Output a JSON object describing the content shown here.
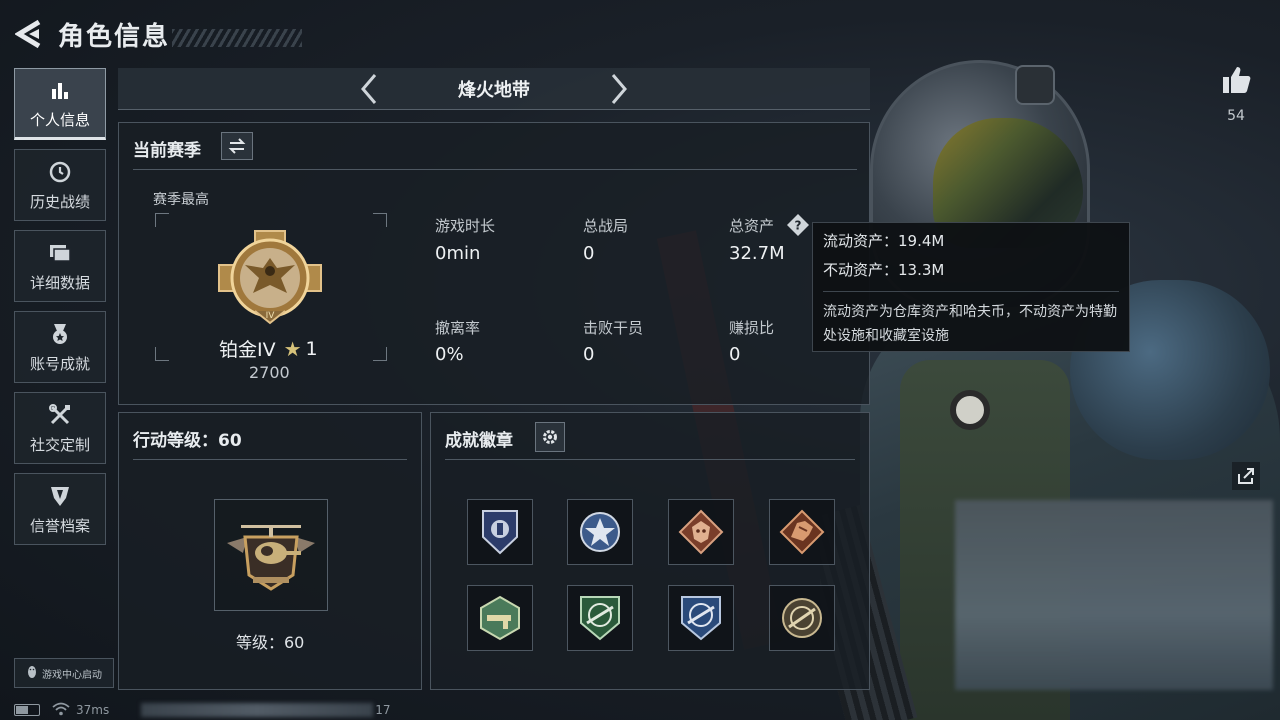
{
  "header": {
    "title": "角色信息"
  },
  "sidebar": {
    "items": [
      {
        "label": "个人信息",
        "icon": "bar-chart-icon",
        "active": true
      },
      {
        "label": "历史战绩",
        "icon": "history-icon"
      },
      {
        "label": "详细数据",
        "icon": "folder-icon"
      },
      {
        "label": "账号成就",
        "icon": "medal-icon"
      },
      {
        "label": "社交定制",
        "icon": "tools-icon"
      },
      {
        "label": "信誉档案",
        "icon": "shield-icon"
      }
    ],
    "launch_label": "游戏中心启动"
  },
  "mode": {
    "title": "烽火地带"
  },
  "season": {
    "title": "当前赛季",
    "best_label": "赛季最高",
    "rank_name": "铂金IV",
    "rank_stars": "1",
    "rank_score": "2700",
    "stats": [
      {
        "label": "游戏时长",
        "value": "0min"
      },
      {
        "label": "总战局",
        "value": "0"
      },
      {
        "label": "总资产",
        "value": "32.7M"
      },
      {
        "label": "撤离率",
        "value": "0%"
      },
      {
        "label": "击败干员",
        "value": "0"
      },
      {
        "label": "赚损比",
        "value": "0"
      }
    ]
  },
  "tooltip": {
    "liquid": "流动资产：19.4M",
    "fixed": "不动资产：13.3M",
    "desc": "流动资产为仓库资产和哈夫币，不动资产为特勤处设施和收藏室设施"
  },
  "level": {
    "title": "行动等级：60",
    "text": "等级：60"
  },
  "badges": {
    "title": "成就徽章",
    "items": [
      {
        "icon": "blue-shield-badge-icon",
        "color": "#3a4f8a"
      },
      {
        "icon": "star-roundel-badge-icon",
        "color": "#4a6a9a"
      },
      {
        "icon": "beast-bronze-badge-icon",
        "color": "#9a5a3a"
      },
      {
        "icon": "dragon-bronze-badge-icon",
        "color": "#8a4a2a"
      },
      {
        "icon": "gun-green-badge-icon",
        "color": "#5a8a5a"
      },
      {
        "icon": "rifle-green-badge-icon",
        "color": "#3a7a4a"
      },
      {
        "icon": "rifle-blue-badge-icon",
        "color": "#3a5a8a"
      },
      {
        "icon": "rifle-gold-badge-icon",
        "color": "#7a6a3a"
      }
    ]
  },
  "likes": {
    "count": "54"
  },
  "status": {
    "ping": "37ms",
    "fps": "17"
  }
}
